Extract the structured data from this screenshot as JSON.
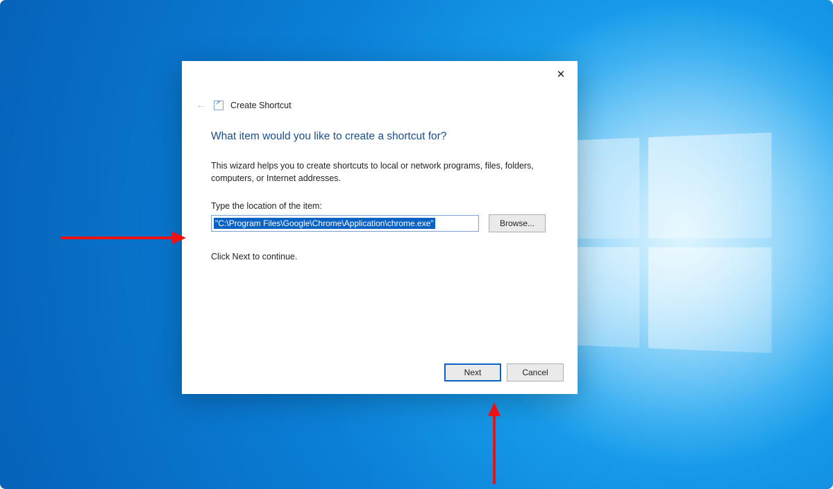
{
  "dialog": {
    "title": "Create Shortcut",
    "heading": "What item would you like to create a shortcut for?",
    "explain": "This wizard helps you to create shortcuts to local or network programs, files, folders, computers, or Internet addresses.",
    "field_label": "Type the location of the item:",
    "path_value": "\"C:\\Program Files\\Google\\Chrome\\Application\\chrome.exe\"",
    "browse_label": "Browse...",
    "continue_text": "Click Next to continue.",
    "next_label": "Next",
    "cancel_label": "Cancel"
  }
}
